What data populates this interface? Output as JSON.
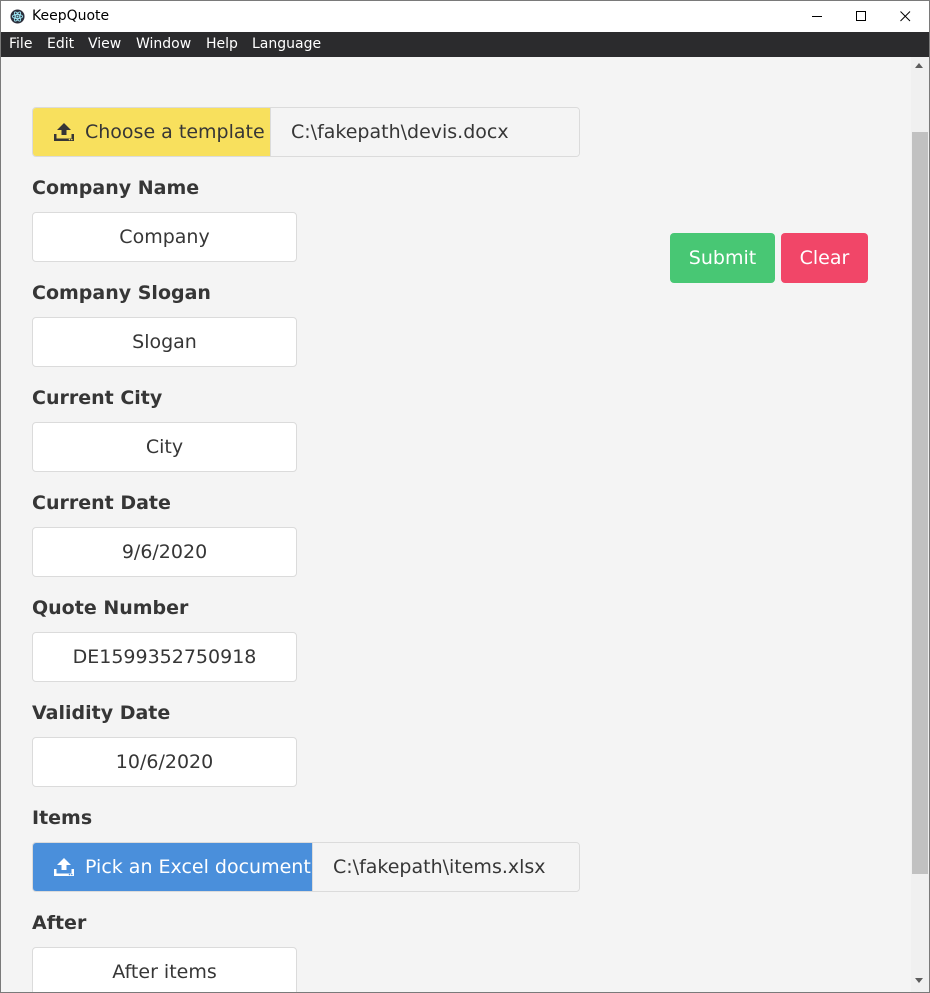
{
  "window": {
    "title": "KeepQuote",
    "icons": [
      "electron-app-icon",
      "minimize-icon",
      "maximize-icon",
      "close-icon"
    ]
  },
  "menu": [
    "File",
    "Edit",
    "View",
    "Window",
    "Help",
    "Language"
  ],
  "template": {
    "button_label": "Choose a template",
    "file_name": "C:\\fakepath\\devis.docx",
    "icon": "upload-icon",
    "color": "#f8e05d"
  },
  "actions": {
    "submit": "Submit",
    "clear": "Clear",
    "submit_color": "#48c774",
    "clear_color": "#f14668"
  },
  "fields": [
    {
      "label": "Company Name",
      "value": "Company"
    },
    {
      "label": "Company Slogan",
      "value": "Slogan"
    },
    {
      "label": "Current City",
      "value": "City"
    },
    {
      "label": "Current Date",
      "value": "9/6/2020"
    },
    {
      "label": "Quote Number",
      "value": "DE1599352750918"
    },
    {
      "label": "Validity Date",
      "value": "10/6/2020"
    }
  ],
  "items": {
    "label": "Items",
    "button_label": "Pick an Excel document",
    "file_name": "C:\\fakepath\\items.xlsx",
    "icon": "upload-icon",
    "color": "#4a8fdb"
  },
  "after": {
    "label": "After",
    "value": "After items"
  }
}
